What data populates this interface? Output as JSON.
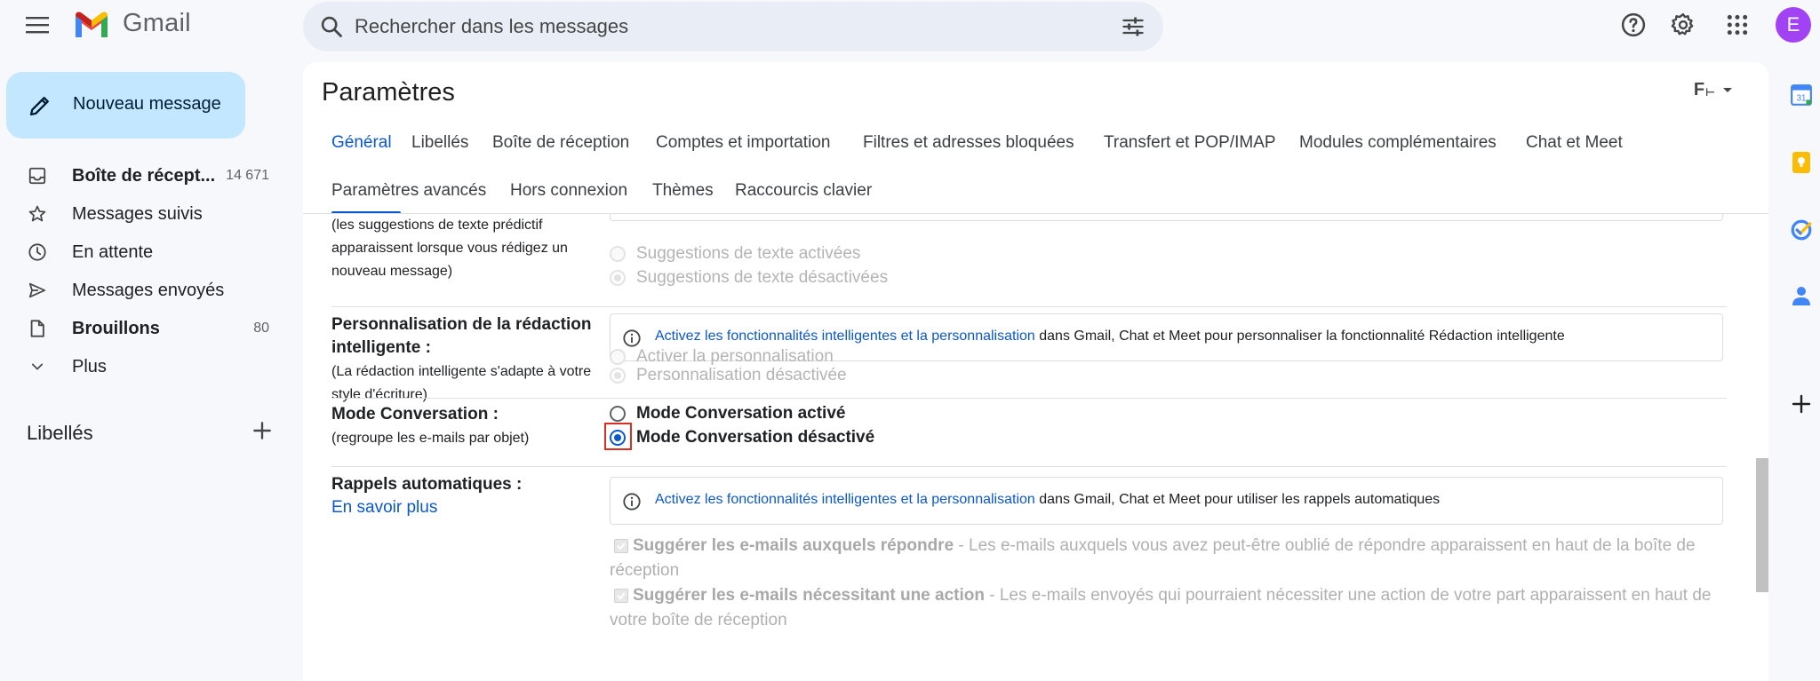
{
  "app": {
    "name": "Gmail",
    "avatar_initial": "E"
  },
  "search": {
    "placeholder": "Rechercher dans les messages"
  },
  "compose": {
    "label": "Nouveau message"
  },
  "nav": {
    "items": [
      {
        "label": "Boîte de récept...",
        "count": "14 671",
        "bold": true
      },
      {
        "label": "Messages suivis",
        "count": ""
      },
      {
        "label": "En attente",
        "count": ""
      },
      {
        "label": "Messages envoyés",
        "count": ""
      },
      {
        "label": "Brouillons",
        "count": "80",
        "bold": true
      },
      {
        "label": "Plus",
        "count": ""
      }
    ],
    "labels_heading": "Libellés"
  },
  "settings": {
    "title": "Paramètres",
    "lang_label": "F",
    "tabs": [
      {
        "label": "Général",
        "active": true
      },
      {
        "label": "Libellés"
      },
      {
        "label": "Boîte de réception"
      },
      {
        "label": "Comptes et importation"
      },
      {
        "label": "Filtres et adresses bloquées"
      },
      {
        "label": "Transfert et POP/IMAP"
      },
      {
        "label": "Modules complémentaires"
      },
      {
        "label": "Chat et Meet"
      },
      {
        "label": "Paramètres avancés"
      },
      {
        "label": "Hors connexion"
      },
      {
        "label": "Thèmes"
      },
      {
        "label": "Raccourcis clavier"
      }
    ],
    "predictive": {
      "desc_lines": [
        "(les suggestions de texte prédictif",
        "apparaissent lorsque vous rédigez un",
        "nouveau message)"
      ],
      "opt_on": "Suggestions de texte activées",
      "opt_off": "Suggestions de texte désactivées"
    },
    "smart_compose": {
      "label": "Personnalisation de la rédaction intelligente :",
      "desc": "(La rédaction intelligente s'adapte à votre style d'écriture)",
      "info_link": "Activez les fonctionnalités intelligentes et la personnalisation",
      "info_text": " dans Gmail, Chat et Meet pour personnaliser la fonctionnalité Rédaction intelligente",
      "opt_on": "Activer la personnalisation",
      "opt_off": "Personnalisation désactivée"
    },
    "conversation": {
      "label": "Mode Conversation :",
      "desc": "(regroupe les e-mails par objet)",
      "opt_on": "Mode Conversation activé",
      "opt_off": "Mode Conversation désactivé"
    },
    "nudges": {
      "label": "Rappels automatiques :",
      "link": "En savoir plus",
      "info_link": "Activez les fonctionnalités intelligentes et la personnalisation",
      "info_text": " dans Gmail, Chat et Meet pour utiliser les rappels automatiques",
      "check1_title": "Suggérer les e-mails auxquels répondre",
      "check1_desc": " - Les e-mails auxquels vous avez peut-être oublié de répondre apparaissent en haut de la boîte de réception",
      "check2_title": "Suggérer les e-mails nécessitant une action",
      "check2_desc": " - Les e-mails envoyés qui pourraient nécessiter une action de votre part apparaissent en haut de votre boîte de réception"
    }
  },
  "colors": {
    "accent": "#0b57d0",
    "compose_bg": "#c2e7ff",
    "highlight": "#d93025",
    "avatar": "#a142f4"
  }
}
